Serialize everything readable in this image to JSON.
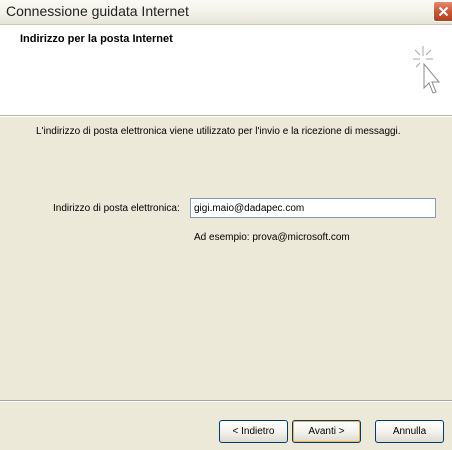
{
  "window": {
    "title": "Connessione guidata Internet"
  },
  "header": {
    "title": "Indirizzo per la posta Internet",
    "icon": "wizard-cursor-icon"
  },
  "main": {
    "description": "L'indirizzo di posta elettronica viene utilizzato per l'invio e la ricezione di messaggi.",
    "email_label": "Indirizzo di posta elettronica:",
    "email_value": "gigi.maio@dadapec.com",
    "example_text": "Ad esempio: prova@microsoft.com"
  },
  "buttons": {
    "back_label": "< Indietro",
    "next_label": "Avanti >",
    "cancel_label": "Annulla"
  },
  "colors": {
    "close_button": "#c85432",
    "dialog_background": "#ece9d8",
    "input_border": "#7f9db9"
  }
}
